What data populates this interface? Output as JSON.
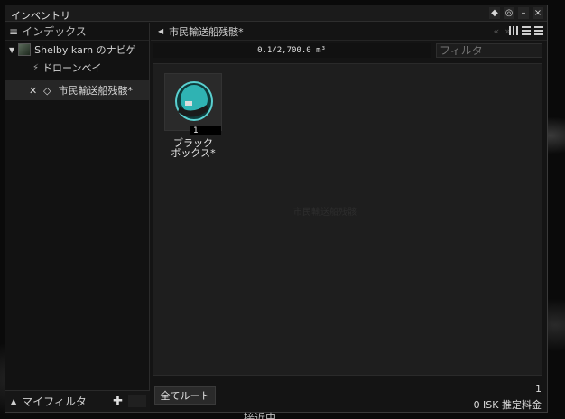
{
  "window": {
    "title": "インベントリ"
  },
  "window_controls": [
    "◆",
    "◎",
    "–",
    "×"
  ],
  "left_panel": {
    "header": "インデックス",
    "ship": {
      "name": "Shelby karn のナビゲ"
    },
    "drone_bay": "ドローンベイ",
    "selected": {
      "name": "市民輸送船残骸*"
    },
    "footer_label": "マイフィルタ"
  },
  "right_panel": {
    "breadcrumb": "市民輸送船残骸*",
    "capacity": "0.1/2,700.0 m³",
    "filter_placeholder": "フィルタ",
    "watermark": "市民輸送船残骸",
    "items": [
      {
        "name_line1": "ブラック",
        "name_line2": "ボックス*",
        "quantity": "1",
        "icon": "black-box-icon"
      }
    ],
    "loot_all_label": "全てルート",
    "item_count": "1",
    "estimated_value": "0 ISK 推定料金"
  },
  "background_text": "接近中"
}
